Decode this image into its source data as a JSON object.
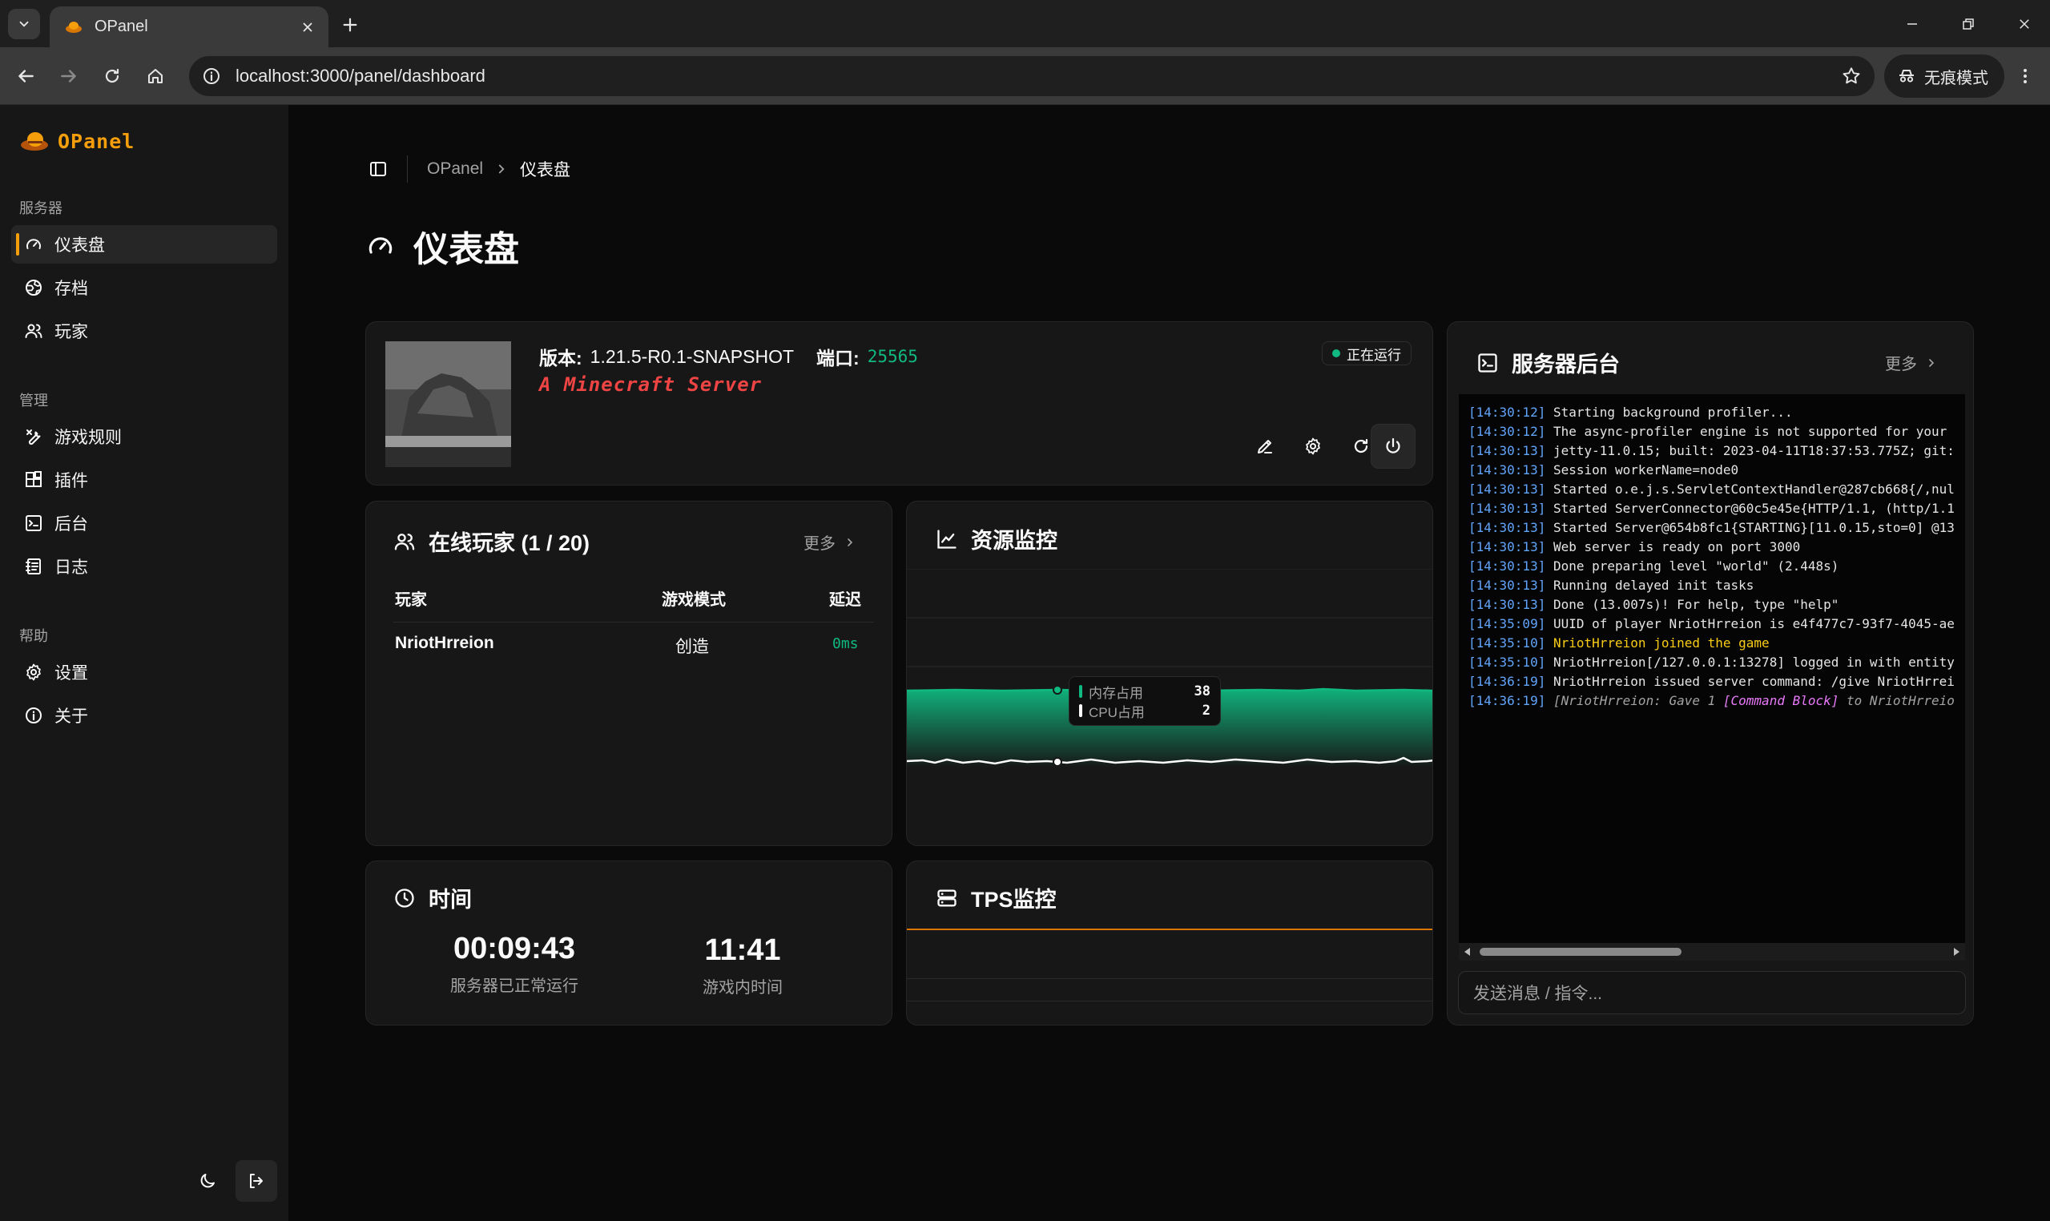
{
  "browser": {
    "tab_title": "OPanel",
    "url": "localhost:3000/panel/dashboard",
    "incognito_label": "无痕模式"
  },
  "sidebar": {
    "brand": "OPanel",
    "groups": [
      {
        "label": "服务器",
        "items": [
          {
            "label": "仪表盘",
            "icon": "gauge-icon",
            "active": true
          },
          {
            "label": "存档",
            "icon": "globe-icon"
          },
          {
            "label": "玩家",
            "icon": "users-icon"
          }
        ]
      },
      {
        "label": "管理",
        "items": [
          {
            "label": "游戏规则",
            "icon": "wrench-icon"
          },
          {
            "label": "插件",
            "icon": "plugin-icon"
          },
          {
            "label": "后台",
            "icon": "terminal-icon"
          },
          {
            "label": "日志",
            "icon": "log-icon"
          }
        ]
      },
      {
        "label": "帮助",
        "items": [
          {
            "label": "设置",
            "icon": "gear-icon"
          },
          {
            "label": "关于",
            "icon": "info-icon"
          }
        ]
      }
    ]
  },
  "breadcrumb": {
    "root": "OPanel",
    "current": "仪表盘"
  },
  "page_title": "仪表盘",
  "server_info": {
    "version_label": "版本:",
    "version": "1.21.5-R0.1-SNAPSHOT",
    "port_label": "端口:",
    "port": "25565",
    "motd": "A Minecraft Server",
    "status": "正在运行"
  },
  "online_players": {
    "title": "在线玩家 (1 / 20)",
    "more": "更多",
    "columns": [
      "玩家",
      "游戏模式",
      "延迟"
    ],
    "rows": [
      {
        "player": "NriotHrreion",
        "mode": "创造",
        "ping": "0ms"
      }
    ]
  },
  "resource_monitor": {
    "title": "资源监控",
    "tooltip": [
      {
        "label": "内存占用",
        "value": "38",
        "color": "#10b981"
      },
      {
        "label": "CPU占用",
        "value": "2",
        "color": "#ffffff"
      }
    ]
  },
  "time_card": {
    "title": "时间",
    "uptime": "00:09:43",
    "uptime_label": "服务器已正常运行",
    "game_time": "11:41",
    "game_time_label": "游戏内时间"
  },
  "tps_monitor": {
    "title": "TPS监控"
  },
  "server_console": {
    "title": "服务器后台",
    "more": "更多",
    "input_placeholder": "发送消息 / 指令...",
    "lines": [
      {
        "ts": "[14:30:12]",
        "msg": "Starting background profiler..."
      },
      {
        "ts": "[14:30:12]",
        "msg": "The async-profiler engine is not supported for your"
      },
      {
        "ts": "[14:30:13]",
        "msg": "jetty-11.0.15; built: 2023-04-11T18:37:53.775Z; git:"
      },
      {
        "ts": "[14:30:13]",
        "msg": "Session workerName=node0"
      },
      {
        "ts": "[14:30:13]",
        "msg": "Started o.e.j.s.ServletContextHandler@287cb668{/,nul"
      },
      {
        "ts": "[14:30:13]",
        "msg": "Started ServerConnector@60c5e45e{HTTP/1.1, (http/1.1"
      },
      {
        "ts": "[14:30:13]",
        "msg": "Started Server@654b8fc1{STARTING}[11.0.15,sto=0] @13"
      },
      {
        "ts": "[14:30:13]",
        "msg": "Web server is ready on port 3000"
      },
      {
        "ts": "[14:30:13]",
        "msg": "Done preparing level \"world\" (2.448s)"
      },
      {
        "ts": "[14:30:13]",
        "msg": "Running delayed init tasks"
      },
      {
        "ts": "[14:30:13]",
        "msg": "Done (13.007s)! For help, type \"help\""
      },
      {
        "ts": "[14:35:09]",
        "msg": "UUID of player NriotHrreion is e4f477c7-93f7-4045-ae"
      },
      {
        "ts": "[14:35:10]",
        "msg": "NriotHrreion joined the game",
        "color": "#facc15"
      },
      {
        "ts": "[14:35:10]",
        "msg": "NriotHrreion[/127.0.0.1:13278] logged in with entity"
      },
      {
        "ts": "[14:36:19]",
        "msg": "NriotHrreion issued server command: /give NriotHrrei"
      }
    ],
    "last_line": {
      "ts": "[14:36:19]",
      "pre": "[NriotHrreion: Gave 1 ",
      "item": "[Command Block]",
      "post": " to NriotHrreio"
    }
  }
}
